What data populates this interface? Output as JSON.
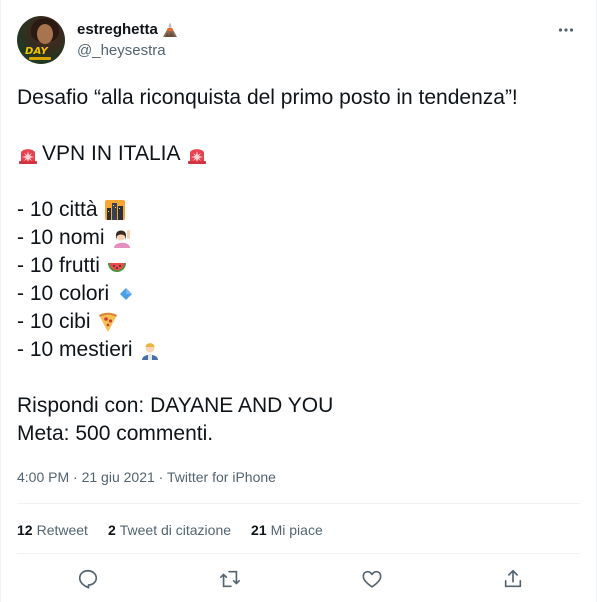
{
  "author": {
    "display_name": "estreghetta",
    "handle": "@_heysestra",
    "avatar_text": "DAY",
    "name_emoji": "volcano-icon"
  },
  "tweet": {
    "lines": [
      "Desafio “alla riconquista del primo posto in tendenza”!",
      "",
      "VPN IN ITALIA",
      "",
      "- 10 città",
      "- 10 nomi",
      "- 10 frutti",
      "- 10 colori",
      "- 10 cibi",
      "- 10 mestieri",
      "",
      "Rispondi con: DAYANE AND YOU",
      "Meta: 500 commenti."
    ],
    "emojis": {
      "siren": "police-light-icon",
      "city": "cityscape-icon",
      "names": "person-raising-hand-icon",
      "fruits": "watermelon-icon",
      "colors": "blue-diamond-icon",
      "food": "pizza-icon",
      "jobs": "worker-icon"
    }
  },
  "meta": {
    "time": "4:00 PM",
    "separator": " · ",
    "date": "21 giu 2021",
    "source": "Twitter for iPhone"
  },
  "stats": {
    "retweets_count": "12",
    "retweets_label": "Retweet",
    "quotes_count": "2",
    "quotes_label": "Tweet di citazione",
    "likes_count": "21",
    "likes_label": "Mi piace"
  },
  "actions": [
    "reply-icon",
    "retweet-icon",
    "like-icon",
    "share-icon"
  ],
  "colors": {
    "text": "#0f1419",
    "secondary": "#536471",
    "divider": "#eff3f4"
  }
}
